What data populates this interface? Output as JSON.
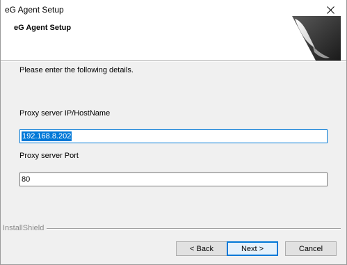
{
  "window": {
    "title": "eG Agent Setup",
    "close_icon": "close-icon"
  },
  "header": {
    "title": "eG Agent Setup",
    "graphic_icon": "page-curl-icon"
  },
  "main": {
    "instruction": "Please enter the following details.",
    "proxy_host": {
      "label": "Proxy server IP/HostName",
      "value": "192.168.8.202",
      "selected": true
    },
    "proxy_port": {
      "label": "Proxy server Port",
      "value": "80"
    }
  },
  "footer": {
    "brand": "InstallShield",
    "back_label": "< Back",
    "next_label": "Next >",
    "cancel_label": "Cancel"
  },
  "colors": {
    "accent": "#0078d7",
    "header_bg": "#ffffff",
    "dialog_bg": "#f0f0f0"
  }
}
